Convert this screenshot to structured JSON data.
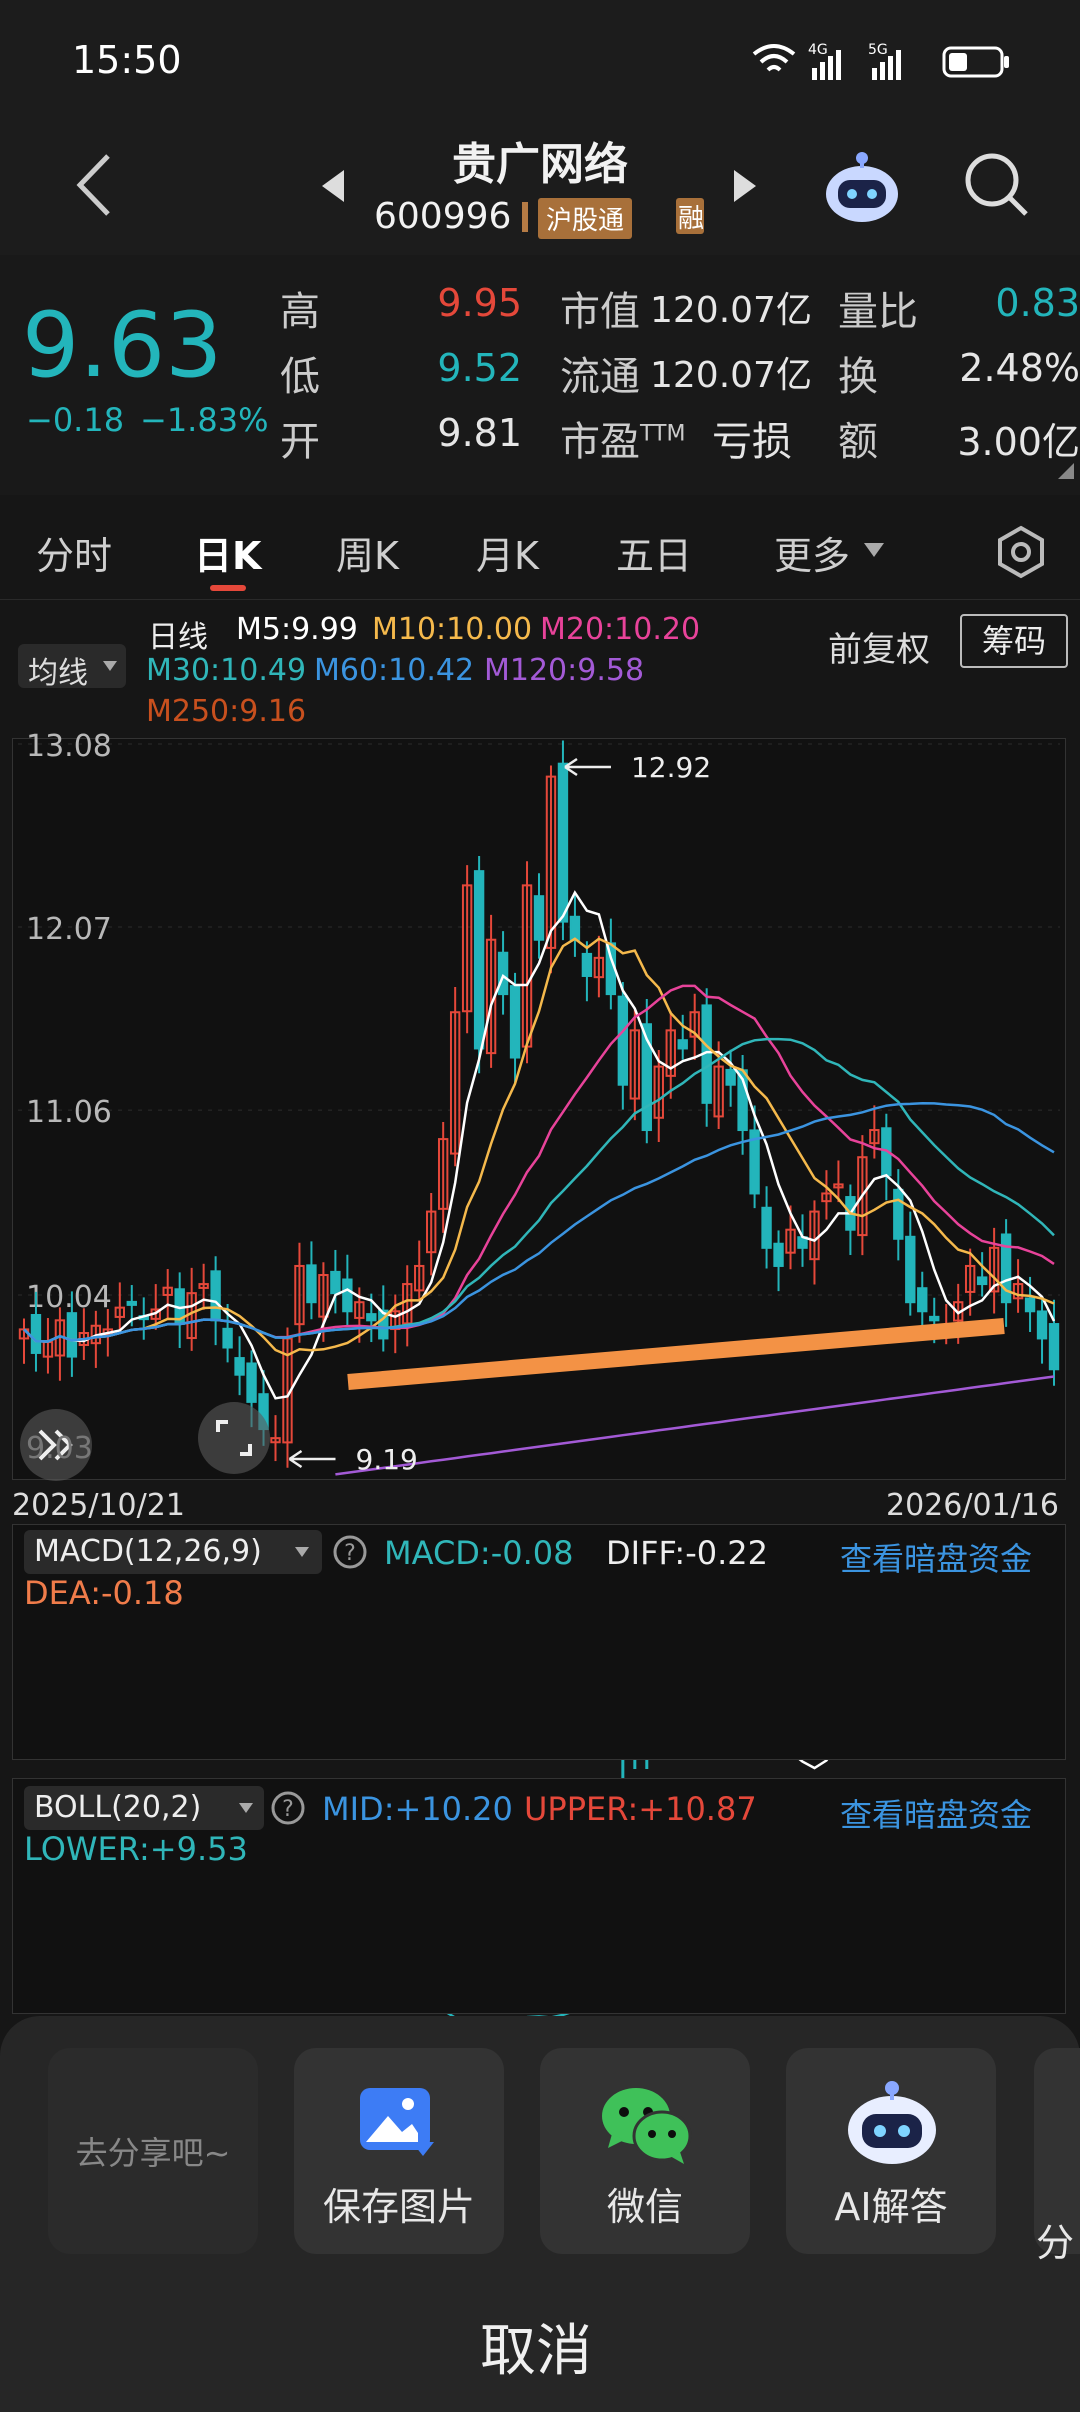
{
  "status": {
    "time": "15:50",
    "net1": "4G",
    "net2": "5G"
  },
  "header": {
    "stock_name": "贵广网络",
    "stock_code": "600996",
    "badge_hgt": "沪股通",
    "badge_rong": "融"
  },
  "quote": {
    "price": "9.63",
    "change": "−0.18",
    "change_pct": "−1.83%",
    "high_label": "高",
    "high": "9.95",
    "low_label": "低",
    "low": "9.52",
    "open_label": "开",
    "open": "9.81",
    "mcap_label": "市值",
    "mcap": "120.07亿",
    "float_label": "流通",
    "float": "120.07亿",
    "pe_label": "市盈TTM",
    "pe": "亏损",
    "vr_label": "量比",
    "vr": "0.83",
    "turnover_label": "换",
    "turnover": "2.48%",
    "amount_label": "额",
    "amount": "3.00亿"
  },
  "tabs": [
    "分时",
    "日K",
    "周K",
    "月K",
    "五日",
    "更多"
  ],
  "active_tab": "日K",
  "ma_legend": {
    "selector": "均线",
    "period": "日线",
    "m5": "M5:9.99",
    "m10": "M10:10.00",
    "m20": "M20:10.20",
    "m30": "M30:10.49",
    "m60": "M60:10.42",
    "m120": "M120:9.58",
    "m250": "M250:9.16",
    "adjust": "前复权",
    "chips": "筹码"
  },
  "colors": {
    "m5": "#ffffff",
    "m10": "#f5b94c",
    "m20": "#e8439a",
    "m30": "#30b6b9",
    "m60": "#3b94e0",
    "m120": "#a35ad6",
    "m250": "#c8501e",
    "up": "#e5483a",
    "down": "#23b5bb",
    "trendline": "#f39245"
  },
  "main_chart": {
    "y_ticks": [
      "13.08",
      "12.07",
      "11.06",
      "10.04"
    ],
    "max_label": "12.92",
    "min_label": "9.19",
    "corner_value": "9.03",
    "date_start": "2025/10/21",
    "date_end": "2026/01/16"
  },
  "chart_data": {
    "type": "candlestick",
    "x": [
      "2025/10/21",
      "2026/01/16"
    ],
    "ylim": [
      9.03,
      13.08
    ],
    "high_marker": 12.92,
    "low_marker": 9.19,
    "close": [
      9.85,
      9.72,
      9.78,
      9.9,
      9.7,
      9.83,
      9.87,
      9.85,
      9.97,
      10.0,
      9.92,
      9.96,
      10.08,
      9.88,
      10.05,
      10.1,
      9.9,
      9.75,
      9.6,
      9.45,
      9.3,
      9.25,
      9.8,
      10.2,
      10.0,
      10.15,
      10.05,
      9.95,
      10.0,
      9.9,
      9.8,
      9.95,
      10.1,
      10.2,
      10.5,
      10.9,
      11.6,
      12.3,
      11.4,
      12.0,
      11.7,
      11.35,
      12.3,
      12.0,
      12.9,
      12.1,
      12.0,
      11.8,
      11.9,
      11.7,
      11.2,
      11.5,
      10.95,
      11.3,
      11.5,
      11.4,
      11.6,
      11.1,
      11.3,
      11.2,
      10.95,
      10.6,
      10.3,
      10.2,
      10.4,
      10.3,
      10.5,
      10.6,
      10.65,
      10.4,
      10.8,
      10.95,
      10.7,
      10.35,
      10.0,
      9.95,
      9.9,
      9.85,
      10.0,
      10.2,
      10.1,
      10.3,
      10.0,
      10.1,
      9.95,
      9.8,
      9.63
    ]
  },
  "macd": {
    "title": "MACD(12,26,9)",
    "macd": "MACD:-0.08",
    "diff": "DIFF:-0.22",
    "dea": "DEA:-0.18",
    "link": "查看暗盘资金"
  },
  "boll": {
    "title": "BOLL(20,2)",
    "mid": "MID:+10.20",
    "upper": "UPPER:+10.87",
    "lower": "LOWER:+9.53",
    "link": "查看暗盘资金"
  },
  "share": {
    "placeholder": "去分享吧~",
    "save": "保存图片",
    "wechat": "微信",
    "ai": "AI解答",
    "more": "分",
    "cancel": "取消"
  }
}
